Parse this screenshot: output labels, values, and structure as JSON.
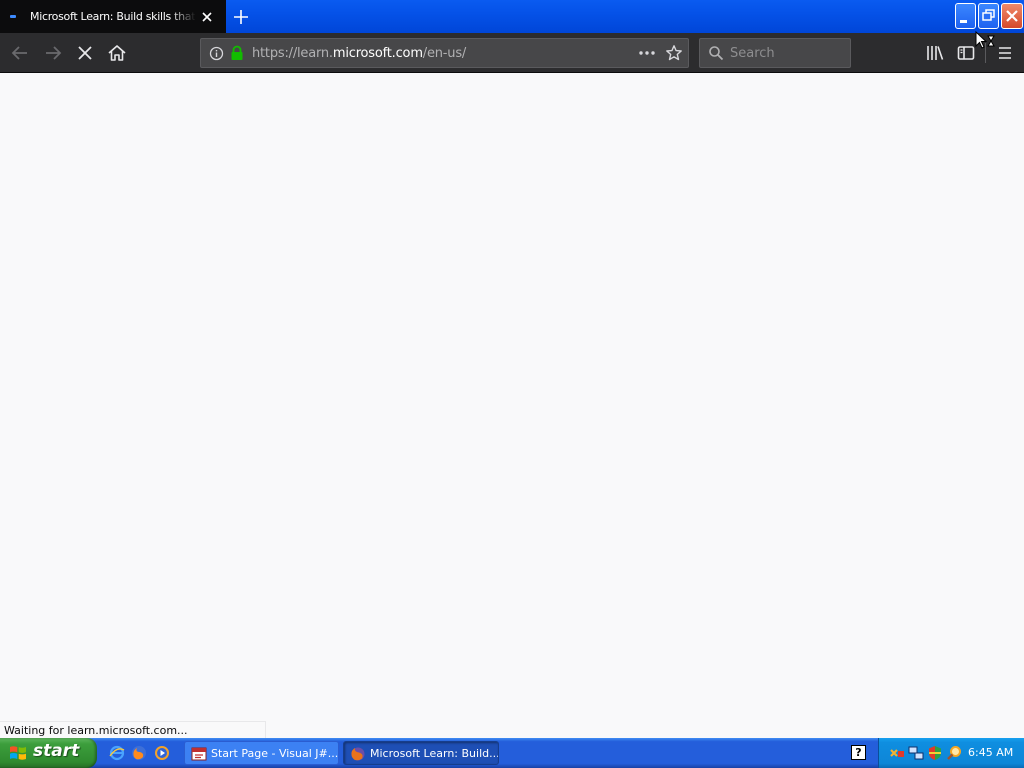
{
  "browser": {
    "tab": {
      "title": "Microsoft Learn: Build skills that open doors in your career"
    },
    "urlbar": {
      "url_prefix": "https://learn.",
      "url_host": "microsoft.com",
      "url_suffix": "/en-us/"
    },
    "search": {
      "placeholder": "Search"
    },
    "status_text": "Waiting for learn.microsoft.com..."
  },
  "taskbar": {
    "start_label": "start",
    "tasks": [
      {
        "label": "Start Page - Visual J#...",
        "icon": "visual-jsharp-icon",
        "active": false
      },
      {
        "label": "Microsoft Learn: Build...",
        "icon": "firefox-icon",
        "active": true
      }
    ],
    "clock": "6:45 AM"
  },
  "colors": {
    "tab_bg": "#0c0c0d",
    "toolbar_bg": "#2c2c2e",
    "urlbar_bg": "#474749",
    "titlebar_blue": "#0552e8",
    "taskbar_blue": "#245edb",
    "start_green": "#3c9e3c",
    "secure_green": "#12bc00"
  }
}
